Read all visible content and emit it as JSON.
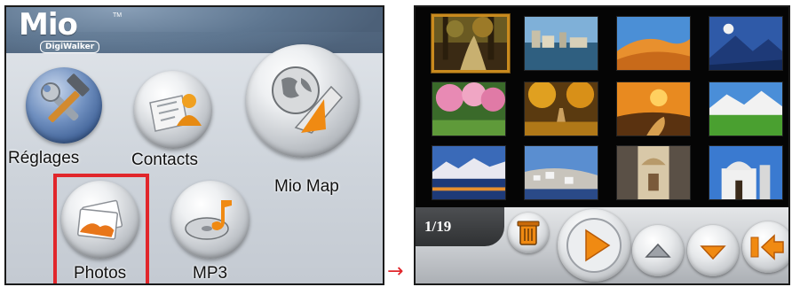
{
  "left_screen": {
    "logo": {
      "brand": "Mio",
      "sub": "DigiWalker",
      "tm": "TM"
    },
    "apps": [
      {
        "id": "settings",
        "label": "Réglages",
        "icon": "tools-icon"
      },
      {
        "id": "contacts",
        "label": "Contacts",
        "icon": "contacts-icon"
      },
      {
        "id": "mio-map",
        "label": "Mio Map",
        "icon": "globe-navigation-icon"
      },
      {
        "id": "photos",
        "label": "Photos",
        "icon": "photos-icon"
      },
      {
        "id": "mp3",
        "label": "MP3",
        "icon": "music-cd-icon"
      }
    ]
  },
  "transition_arrow": "→",
  "right_screen": {
    "counter": "1/19",
    "thumbnails": [
      {
        "subject": "forest path",
        "selected": true
      },
      {
        "subject": "city waterfront",
        "selected": false
      },
      {
        "subject": "desert dunes",
        "selected": false
      },
      {
        "subject": "mountain night sky",
        "selected": false
      },
      {
        "subject": "blossom trees",
        "selected": false
      },
      {
        "subject": "autumn alley",
        "selected": false
      },
      {
        "subject": "sunset road",
        "selected": false
      },
      {
        "subject": "alpine meadow",
        "selected": false
      },
      {
        "subject": "lake mountains",
        "selected": false
      },
      {
        "subject": "coastal village",
        "selected": false
      },
      {
        "subject": "domed church",
        "selected": false
      },
      {
        "subject": "chapel sea",
        "selected": false
      }
    ],
    "controls": [
      {
        "id": "delete",
        "icon": "trash-icon"
      },
      {
        "id": "play",
        "icon": "play-icon"
      },
      {
        "id": "page-up",
        "icon": "triangle-up-icon"
      },
      {
        "id": "page-down",
        "icon": "triangle-down-icon"
      },
      {
        "id": "back",
        "icon": "back-arrow-icon"
      }
    ]
  },
  "colors": {
    "highlight": "#e1262b",
    "selection": "#c98a1e",
    "accent_orange": "#f08a12"
  }
}
